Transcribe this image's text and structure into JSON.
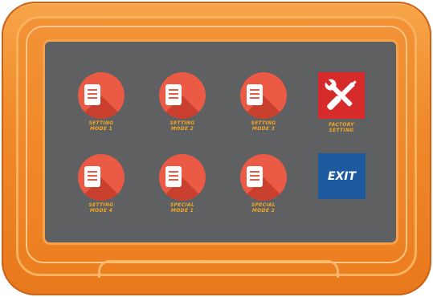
{
  "buttons": {
    "setting_mode_1": {
      "line1": "SETTING",
      "line2": "MODE 1"
    },
    "setting_mode_2": {
      "line1": "SETTING",
      "line2": "MODE 2"
    },
    "setting_mode_3": {
      "line1": "SETTING",
      "line2": "MODE 3"
    },
    "setting_mode_4": {
      "line1": "SETTING",
      "line2": "MODE 4"
    },
    "special_mode_1": {
      "line1": "SPECIAL",
      "line2": "MODE 1"
    },
    "special_mode_2": {
      "line1": "SPECIAL",
      "line2": "MODE 2"
    }
  },
  "factory_setting": {
    "line1": "FACTORY",
    "line2": "SETTING",
    "icon": "tools-icon"
  },
  "exit": {
    "label": "EXIT"
  },
  "colors": {
    "frame": "#f08a2a",
    "screen": "#5f6061",
    "mode_button": "#ea5a45",
    "factory_tile": "#d72b2b",
    "exit_tile": "#1e5aa0",
    "label_text": "#f5a623"
  }
}
